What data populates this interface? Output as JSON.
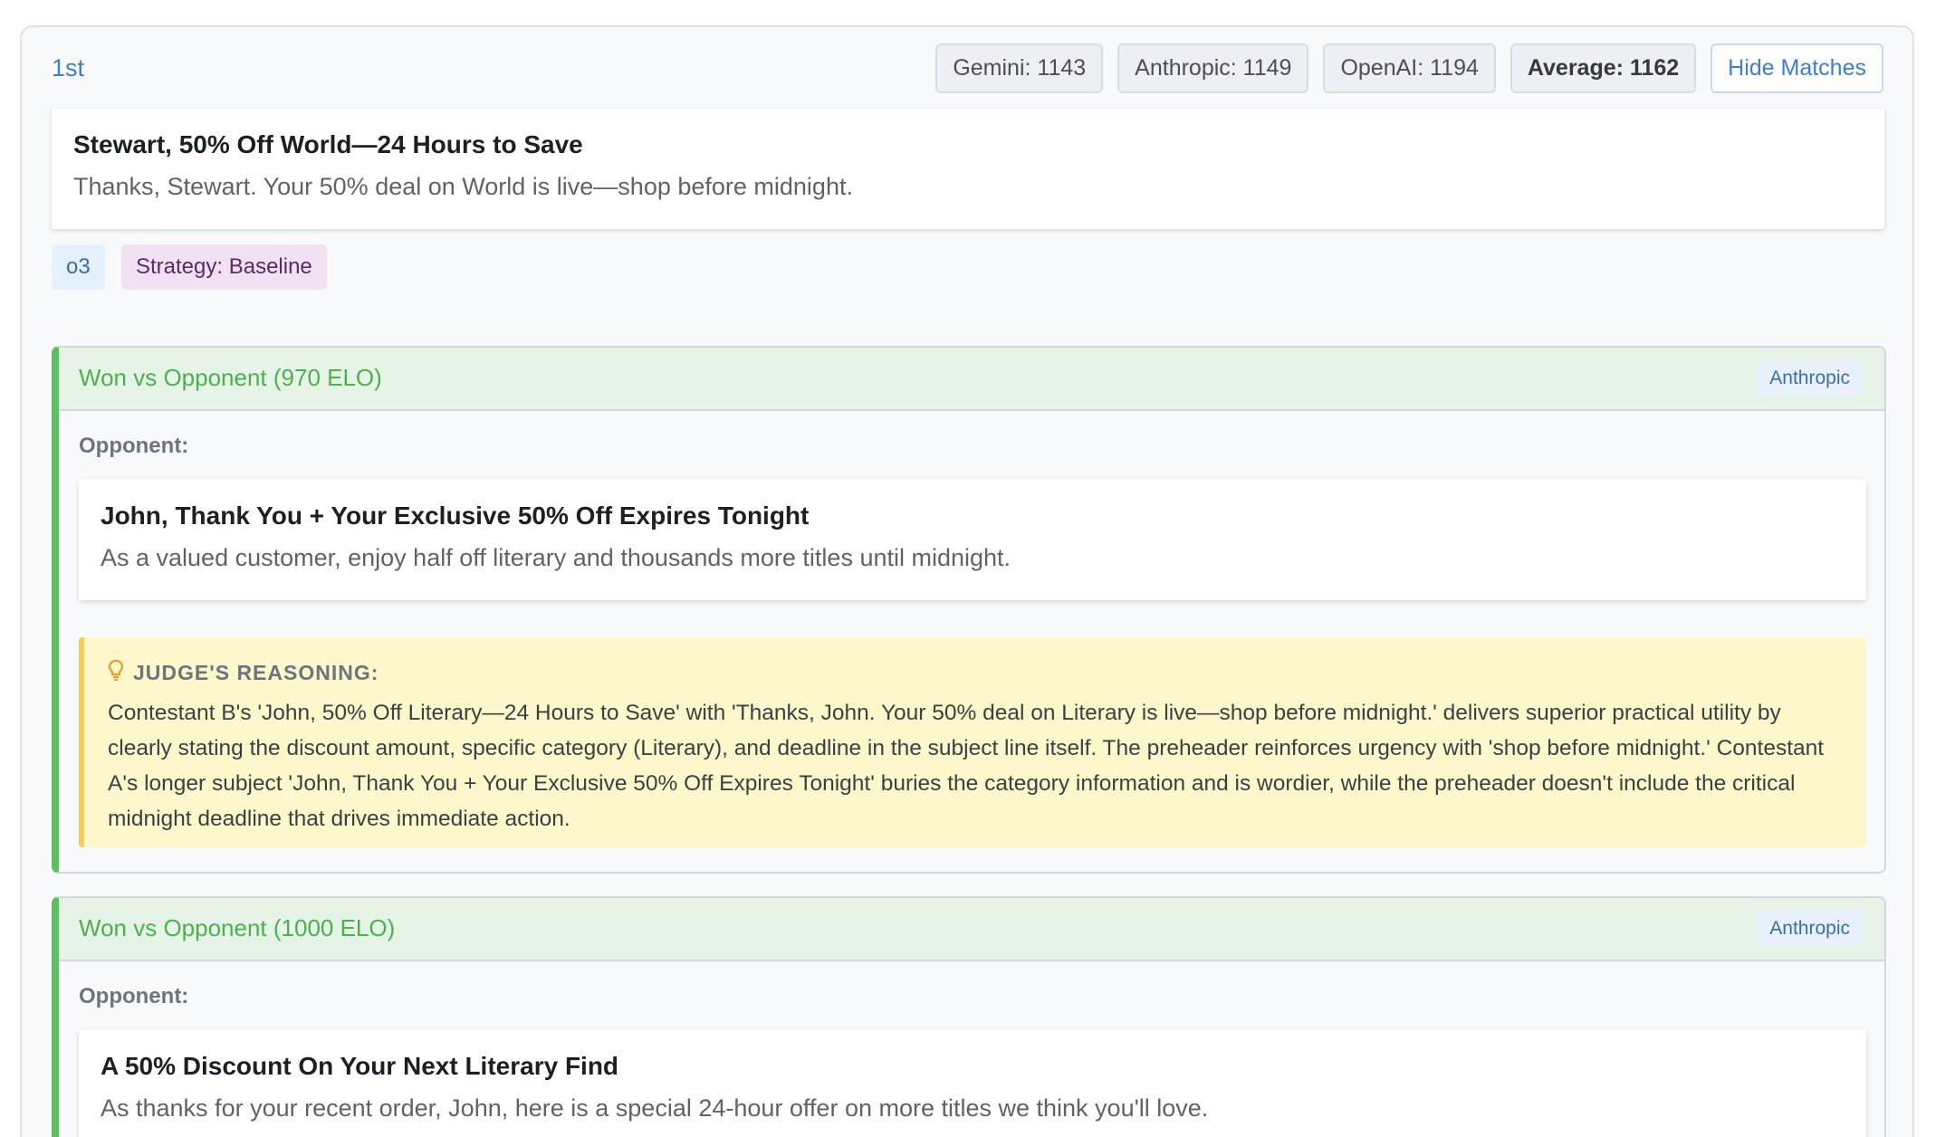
{
  "entry": {
    "rank": "1st",
    "scores": [
      {
        "label": "Gemini: 1143"
      },
      {
        "label": "Anthropic: 1149"
      },
      {
        "label": "OpenAI: 1194"
      }
    ],
    "average": "Average: 1162",
    "hide_label": "Hide Matches",
    "email": {
      "subject": "Stewart, 50% Off World—24 Hours to Save",
      "preheader": "Thanks, Stewart. Your 50% deal on World is live—shop before midnight."
    },
    "tags": {
      "model": "o3",
      "strategy": "Strategy: Baseline"
    }
  },
  "matches": [
    {
      "result": "Won vs Opponent (970 ELO)",
      "judge": "Anthropic",
      "opponent_label": "Opponent:",
      "opponent": {
        "subject": "John, Thank You + Your Exclusive 50% Off Expires Tonight",
        "preheader": "As a valued customer, enjoy half off literary and thousands more titles until midnight."
      },
      "reasoning_title": "JUDGE'S REASONING:",
      "reasoning": "Contestant B's 'John, 50% Off Literary—24 Hours to Save' with 'Thanks, John. Your 50% deal on Literary is live—shop before midnight.' delivers superior practical utility by clearly stating the discount amount, specific category (Literary), and deadline in the subject line itself. The preheader reinforces urgency with 'shop before midnight.' Contestant A's longer subject 'John, Thank You + Your Exclusive 50% Off Expires Tonight' buries the category information and is wordier, while the preheader doesn't include the critical midnight deadline that drives immediate action."
    },
    {
      "result": "Won vs Opponent (1000 ELO)",
      "judge": "Anthropic",
      "opponent_label": "Opponent:",
      "opponent": {
        "subject": "A 50% Discount On Your Next Literary Find",
        "preheader": "As thanks for your recent order, John, here is a special 24-hour offer on more titles we think you'll love."
      }
    }
  ],
  "colors": {
    "accent": "#3b7dd8",
    "win": "#4cb050",
    "reasoning_bg": "#fcf8cc"
  },
  "icons": {
    "reasoning": "lightbulb-icon"
  }
}
